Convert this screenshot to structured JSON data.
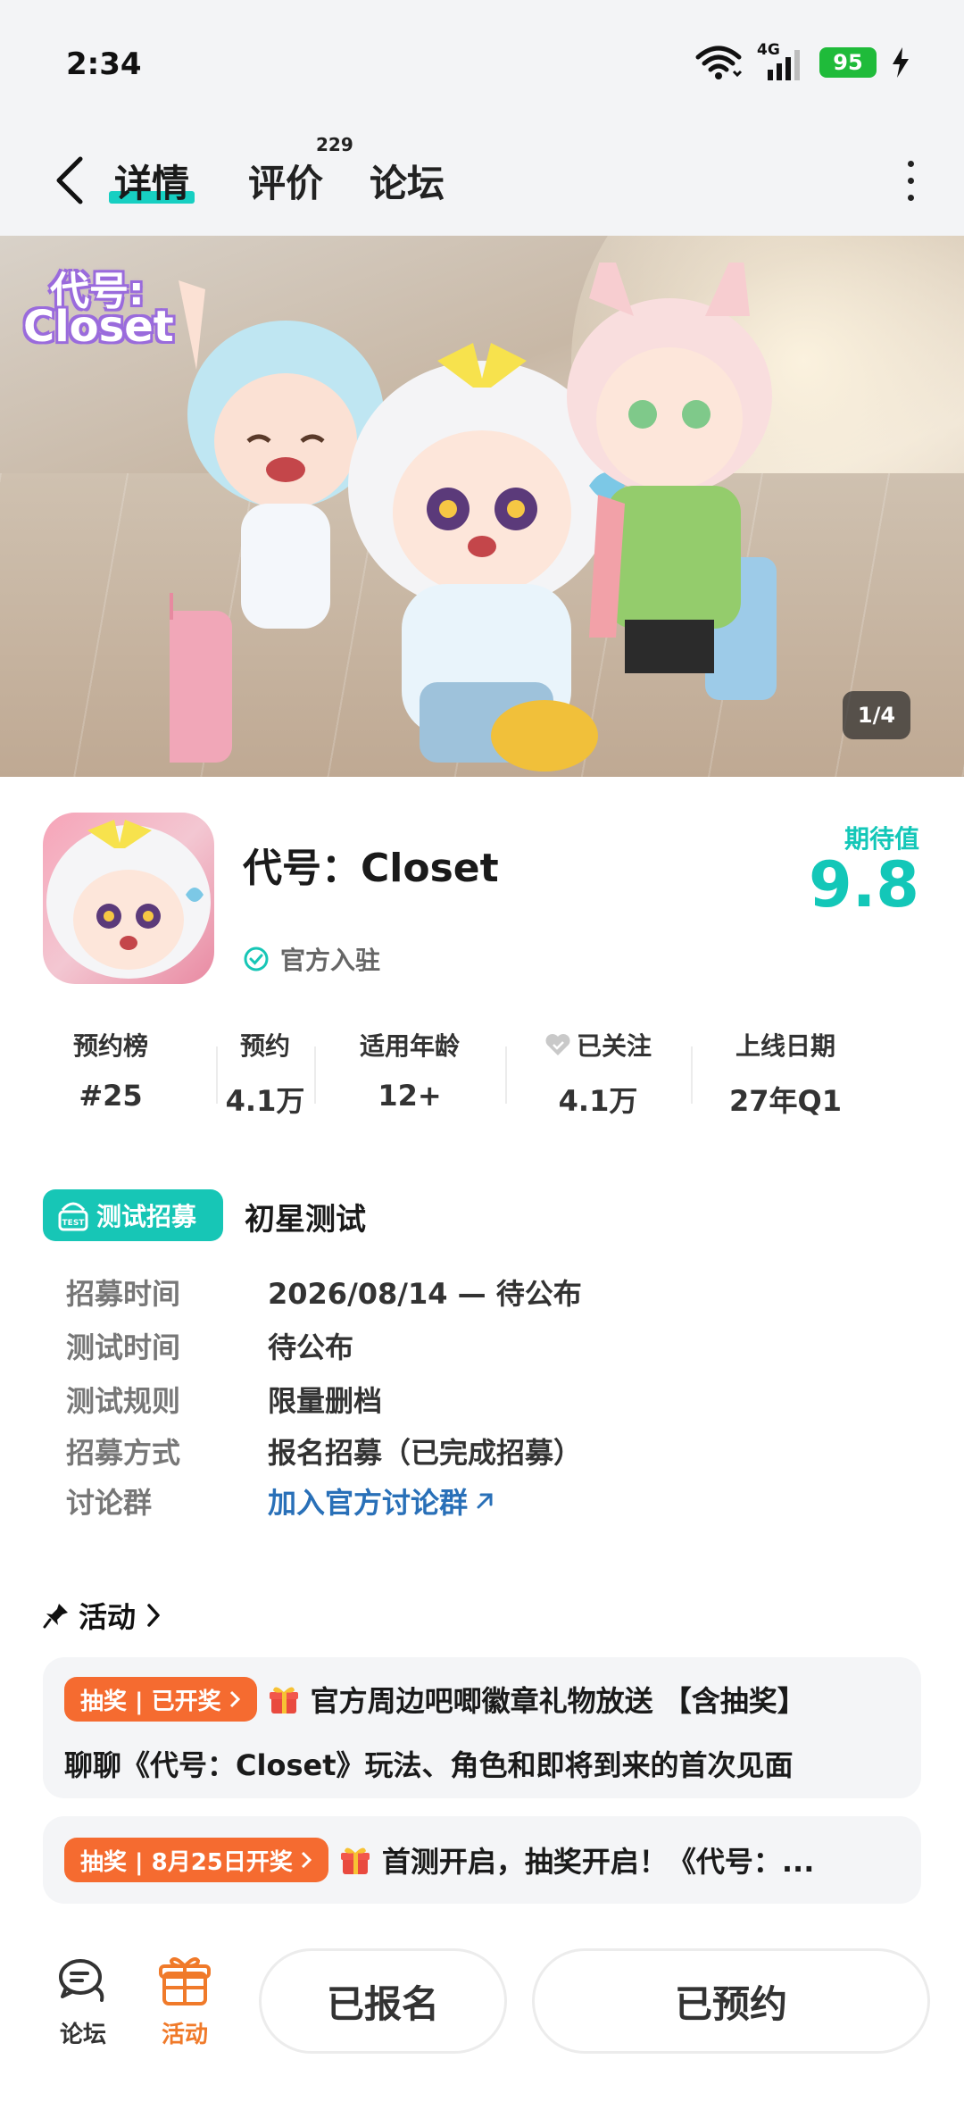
{
  "status_bar": {
    "time": "2:34",
    "battery": "95",
    "network": "4G"
  },
  "header": {
    "tabs": [
      {
        "label": "详情",
        "active": true
      },
      {
        "label": "评价",
        "badge": "229"
      },
      {
        "label": "论坛"
      }
    ]
  },
  "banner": {
    "logo_line1": "代号:",
    "logo_line2": "Closet",
    "page_indicator": "1/4"
  },
  "game": {
    "title": "代号：Closet",
    "official_label": "官方入驻",
    "expect_label": "期待值",
    "expect_value": "9.8"
  },
  "stats": [
    {
      "label": "预约榜",
      "value": "#25"
    },
    {
      "label": "预约",
      "value": "4.1万"
    },
    {
      "label": "适用年龄",
      "value": "12+"
    },
    {
      "label": "已关注",
      "value": "4.1万",
      "icon": "heart-icon"
    },
    {
      "label": "上线日期",
      "value": "27年Q1"
    }
  ],
  "recruit": {
    "tag": "测试招募",
    "tag_icon_text": "TEST",
    "title": "初星测试",
    "rows": [
      {
        "key": "招募时间",
        "value": "2026/08/14 — 待公布"
      },
      {
        "key": "测试时间",
        "value": "待公布"
      },
      {
        "key": "测试规则",
        "value": "限量删档"
      },
      {
        "key": "招募方式",
        "value": "报名招募（已完成招募）"
      },
      {
        "key": "讨论群",
        "value": "加入官方讨论群"
      }
    ]
  },
  "activity": {
    "heading": "活动",
    "items": [
      {
        "badge": "抽奖 | 已开奖",
        "line1": "官方周边吧唧徽章礼物放送 【含抽奖】",
        "line2": "聊聊《代号：Closet》玩法、角色和即将到来的首次见面"
      },
      {
        "badge": "抽奖 | 8月25日开奖",
        "line1": "首测开启，抽奖开启！《代号：..."
      }
    ]
  },
  "bottom": {
    "nav": [
      {
        "label": "论坛",
        "icon": "forum-icon"
      },
      {
        "label": "活动",
        "icon": "gift-icon"
      }
    ],
    "signed_button": "已报名",
    "reserved_button": "已预约"
  },
  "colors": {
    "accent": "#17cfc2",
    "orange": "#f56b30",
    "link": "#2970b8",
    "battery": "#1fbb3a"
  }
}
